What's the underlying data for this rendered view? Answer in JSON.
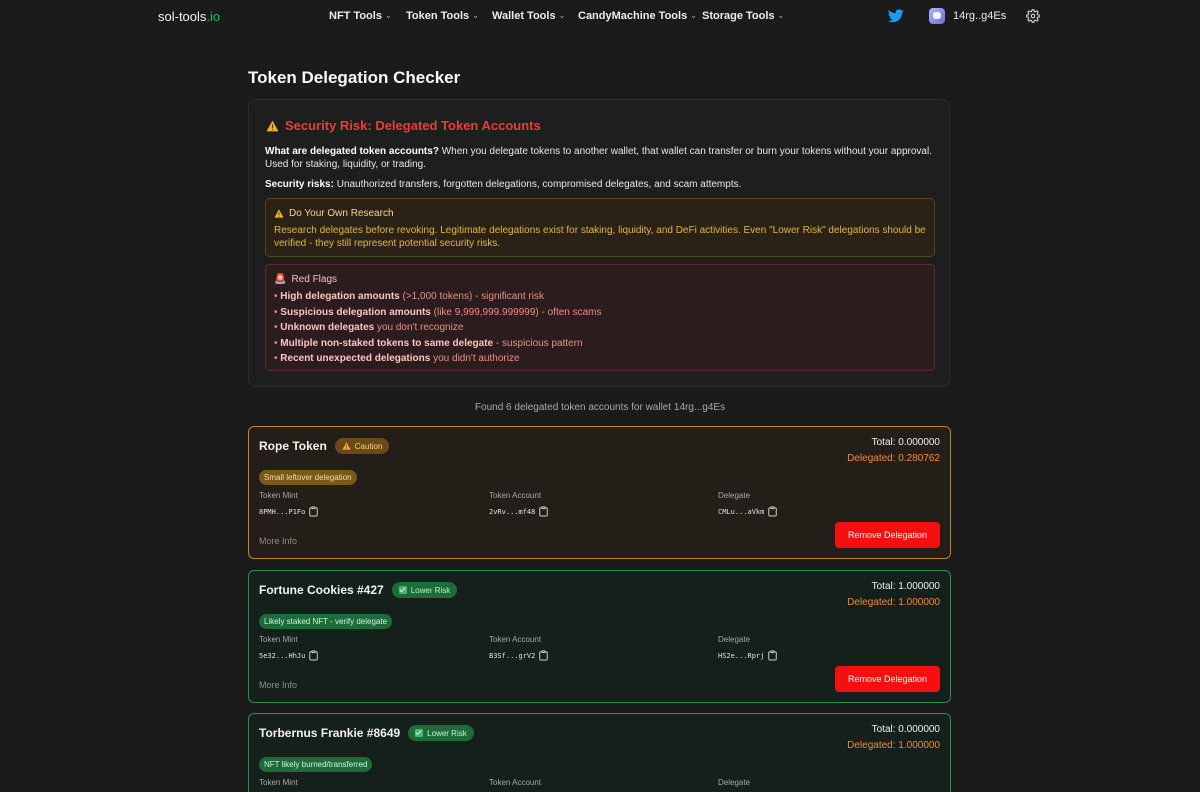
{
  "nav": {
    "logo_main": "sol-tools",
    "logo_tld": ".io",
    "menus": [
      "NFT Tools",
      "Token Tools",
      "Wallet Tools",
      "CandyMachine Tools",
      "Storage Tools"
    ],
    "wallet_address": "14rg..g4Es",
    "icons": [
      "twitter-icon",
      "wallet-avatar",
      "gear-icon"
    ]
  },
  "page": {
    "title": "Token Delegation Checker"
  },
  "info": {
    "risk_title": "Security Risk: Delegated Token Accounts",
    "what_label": "What are delegated token accounts?",
    "what_text": " When you delegate tokens to another wallet, that wallet can transfer or burn your tokens without your approval. Used for staking, liquidity, or trading.",
    "risks_label": "Security risks:",
    "risks_text": " Unauthorized transfers, forgotten delegations, compromised delegates, and scam attempts.",
    "dyor_title": "Do Your Own Research",
    "dyor_body": "Research delegates before revoking. Legitimate delegations exist for staking, liquidity, and DeFi activities. Even \"Lower Risk\" delegations should be verified - they still represent potential security risks.",
    "redflags_icon": "🚨",
    "redflags_title": "Red Flags",
    "redflags": [
      {
        "bold": "High delegation amounts",
        "rest": " (>1,000 tokens) - significant risk"
      },
      {
        "bold": "Suspicious delegation amounts",
        "rest": " (like 9,999,999.999999) - often scams"
      },
      {
        "bold": "Unknown delegates",
        "rest": " you don't recognize"
      },
      {
        "bold": "Multiple non-staked tokens to same delegate",
        "rest": " - suspicious pattern"
      },
      {
        "bold": "Recent unexpected delegations",
        "rest": " you didn't authorize"
      }
    ]
  },
  "found_text": "Found 6 delegated token accounts for wallet 14rg...g4Es",
  "labels": {
    "token_mint": "Token Mint",
    "token_account": "Token Account",
    "delegate": "Delegate",
    "more_info": "More Info",
    "remove": "Remove Delegation"
  },
  "cards": [
    {
      "name": "Rope Token",
      "risk": "Caution",
      "total": "Total: 0.000000",
      "delegated": "Delegated: 0.280762",
      "note": "Small leftover delegation",
      "mint": "8PMH...P1Fo",
      "account": "2vRv...mf48",
      "delegate": "CMLu...aVkm"
    },
    {
      "name": "Fortune Cookies #427",
      "risk": "Lower Risk",
      "total": "Total: 1.000000",
      "delegated": "Delegated: 1.000000",
      "note": "Likely staked NFT - verify delegate",
      "mint": "5e32...HhJu",
      "account": "B3Sf...grV2",
      "delegate": "HS2e...Rprj"
    },
    {
      "name": "Torbernus Frankie #8649",
      "risk": "Lower Risk",
      "total": "Total: 0.000000",
      "delegated": "Delegated: 1.000000",
      "note": "NFT likely burned/transferred",
      "mint": "",
      "account": "",
      "delegate": ""
    }
  ],
  "colors": {
    "background": "#1b1b1b",
    "danger": "#ef3b3b",
    "caution_border": "#b9852a",
    "lower_border": "#2f8a52",
    "remove_button": "#f50f0f",
    "delegated_text": "#f08a3a",
    "logo_accent": "#22c55e"
  }
}
